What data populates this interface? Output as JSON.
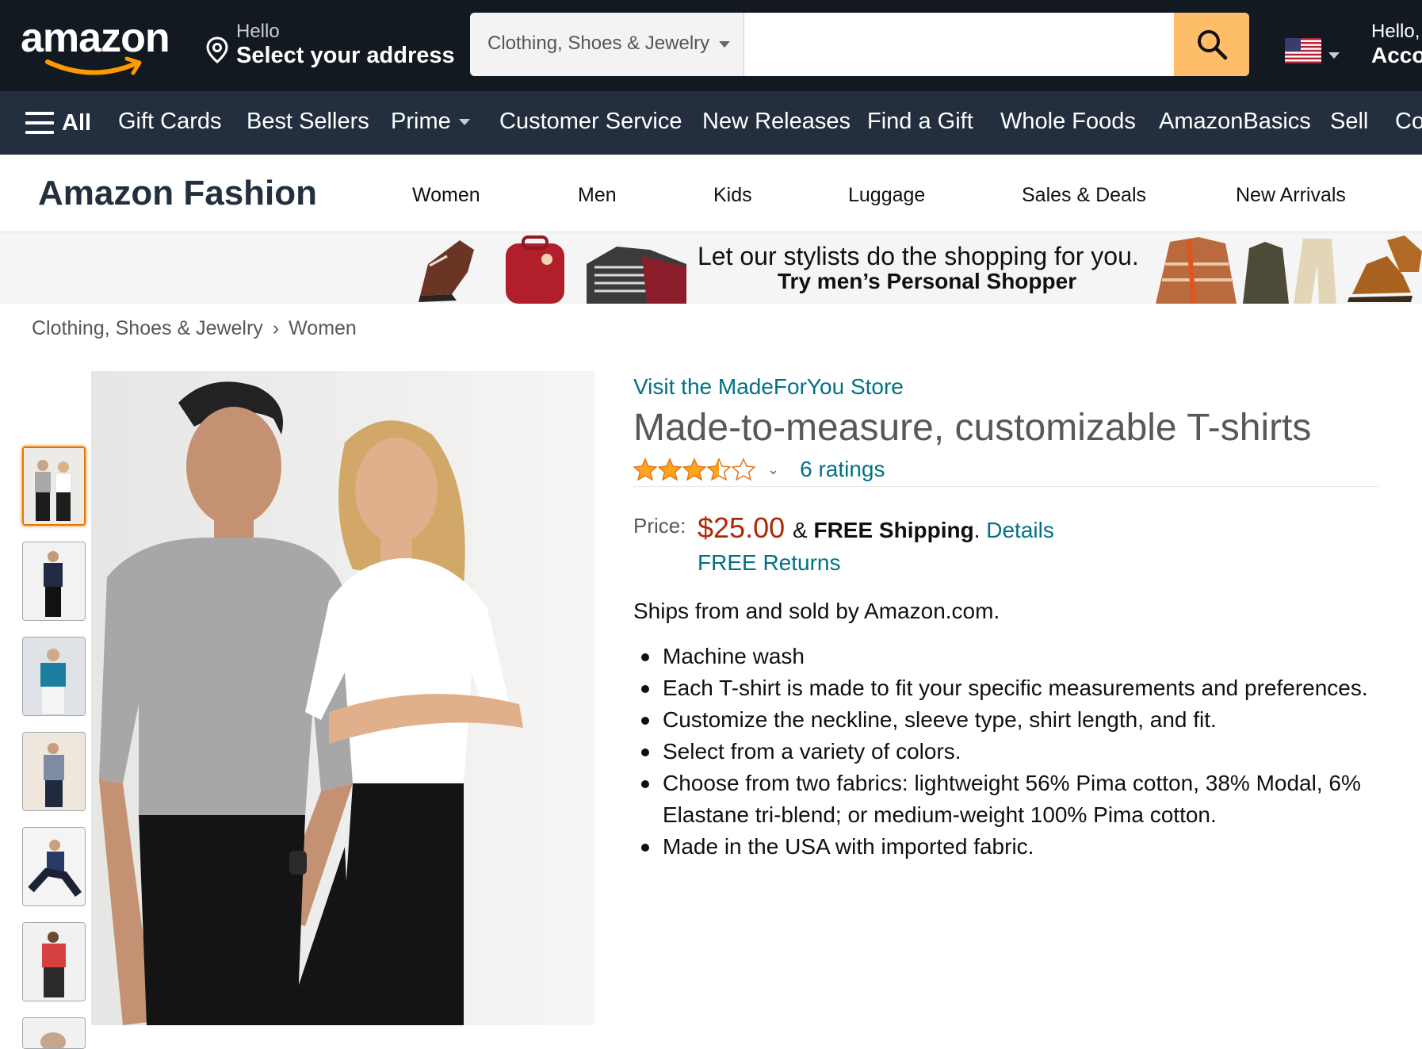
{
  "header": {
    "logo_text": "amazon",
    "address_hello": "Hello",
    "address_main": "Select your address",
    "search": {
      "category": "Clothing, Shoes & Jewelry",
      "placeholder": "",
      "icon": "search-icon"
    },
    "flag_icon": "us-flag-icon",
    "account_hello": "Hello,",
    "account_main": "Acco"
  },
  "nav": {
    "all_label": "All",
    "items": [
      "Gift Cards",
      "Best Sellers",
      "Prime",
      "Customer Service",
      "New Releases",
      "Find a Gift",
      "Whole Foods",
      "AmazonBasics",
      "Sell",
      "Co"
    ]
  },
  "fashion": {
    "title": "Amazon Fashion",
    "links": [
      "Women",
      "Men",
      "Kids",
      "Luggage",
      "Sales & Deals",
      "New Arrivals"
    ]
  },
  "banner": {
    "line1": "Let our stylists do the shopping for you.",
    "line2": "Try men’s Personal Shopper"
  },
  "breadcrumb": {
    "items": [
      "Clothing, Shoes & Jewelry",
      "Women"
    ],
    "separator": "›"
  },
  "product": {
    "store_link": "Visit the MadeForYou Store",
    "title": "Made-to-measure, customizable T-shirts",
    "rating_stars": 3.5,
    "rating_max": 5,
    "ratings_count": "6 ratings",
    "price_label": "Price:",
    "price": "$25.00",
    "shipping_prefix": "& ",
    "shipping_bold": "FREE Shipping",
    "shipping_suffix": ". ",
    "details_link": "Details",
    "free_returns": "FREE Returns",
    "ships_from": "Ships from and sold by Amazon.com.",
    "bullets": [
      "Machine wash",
      "Each T-shirt is made to fit your specific measurements and preferences.",
      "Customize the neckline, sleeve type, shirt length, and fit.",
      "Select from a variety of colors.",
      "Choose from two fabrics: lightweight 56% Pima cotton, 38% Modal, 6% Elastane tri-blend; or medium-weight 100% Pima cotton.",
      "Made in the USA with imported fabric."
    ]
  },
  "colors": {
    "topbar": "#131921",
    "navbar": "#232f3e",
    "search_button": "#febd69",
    "link": "#007185",
    "price": "#b12704",
    "star": "#ffa41c",
    "thumb_active": "#e77600"
  }
}
